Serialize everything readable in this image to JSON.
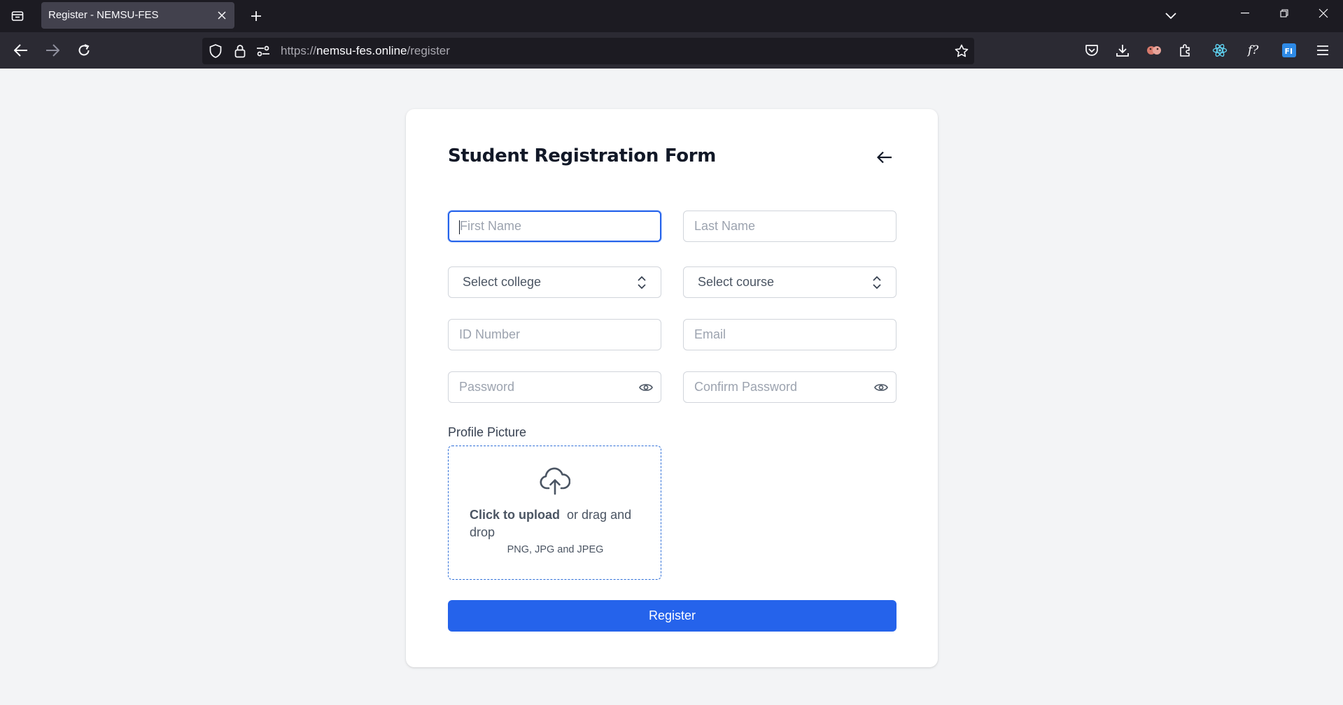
{
  "browser": {
    "tab": {
      "title": "Register - NEMSU-FES"
    },
    "url": {
      "scheme": "https://",
      "host": "nemsu-fes.online",
      "path": "/register"
    },
    "icons": [
      "tab-overview-icon",
      "close-icon",
      "plus-icon",
      "chevron-down-icon",
      "minimize-icon",
      "restore-icon",
      "window-close-icon",
      "back-icon",
      "forward-icon",
      "reload-icon",
      "shield-icon",
      "lock-icon",
      "permissions-icon",
      "star-icon",
      "pocket-icon",
      "download-icon",
      "extension-icons",
      "puzzle-icon",
      "react-icon",
      "function-icon",
      "fi-icon",
      "menu-icon"
    ]
  },
  "form": {
    "title": "Student Registration Form",
    "first_name_placeholder": "First Name",
    "last_name_placeholder": "Last Name",
    "college_select": "Select college",
    "course_select": "Select course",
    "id_placeholder": "ID Number",
    "email_placeholder": "Email",
    "password_placeholder": "Password",
    "confirm_password_placeholder": "Confirm Password",
    "profile_picture_label": "Profile Picture",
    "upload": {
      "click_label": "Click to upload",
      "drag_label": "or drag and drop",
      "hint": "PNG, JPG and JPEG"
    },
    "register_label": "Register"
  },
  "colors": {
    "accent": "#2563eb",
    "page_bg": "#f3f4f6",
    "chrome_dark": "#1c1b22",
    "toolbar": "#2b2a33"
  }
}
